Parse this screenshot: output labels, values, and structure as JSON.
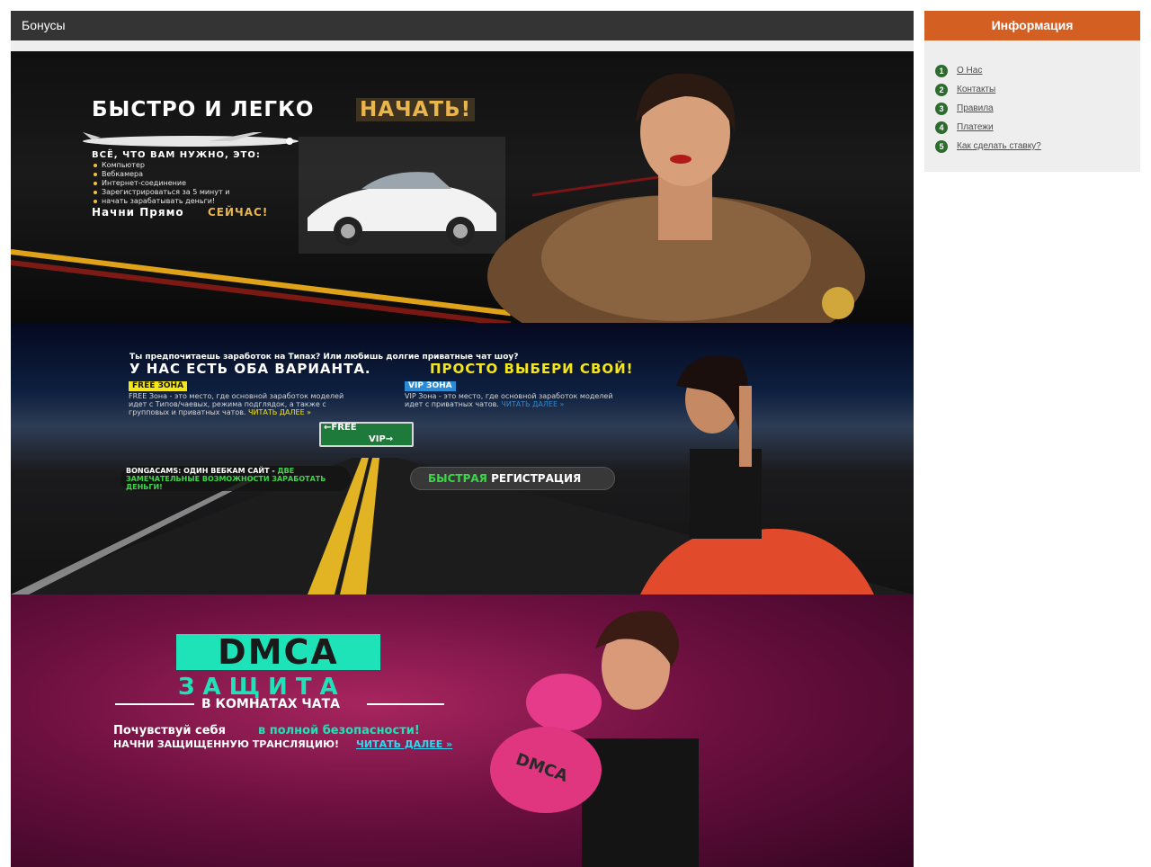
{
  "main": {
    "title": "Бонусы",
    "banners": [
      {
        "title": "БЫСТРО И ЛЕГКО",
        "title_accent": "НАЧАТЬ!",
        "need_heading": "ВСЁ, ЧТО ВАМ НУЖНО, ЭТО:",
        "items": [
          "Компьютер",
          "Вебкамера",
          "Интернет-соединение",
          "Зарегистрироваться за 5 минут и",
          "начать зарабатывать деньги!"
        ],
        "cta": "Начни Прямо",
        "cta_accent": "СЕЙЧАС!"
      },
      {
        "question": "Ты предпочитаешь заработок на Типах? Или любишь долгие приватные чат шоу?",
        "heading": "У НАС ЕСТЬ ОБА ВАРИАНТА.",
        "heading_accent": "ПРОСТО ВЫБЕРИ СВОЙ!",
        "free_tag": "FREE ЗОНА",
        "free_desc": "FREE Зона - это место, где основной заработок моделей идет с Типов/чаевых, режима подглядок, а также с групповых и приватных чатов.",
        "free_more": "ЧИТАТЬ ДАЛЕЕ »",
        "vip_tag": "VIP ЗОНА",
        "vip_desc": "VIP Зона - это место, где основной заработок моделей идет с приватных чатов.",
        "vip_more": "ЧИТАТЬ ДАЛЕЕ »",
        "sign_free": "←FREE",
        "sign_vip": "VIP→",
        "pill_left": "BONGACAMS: ОДИН ВЕБКАМ САЙТ -",
        "pill_left_accent": "ДВЕ ЗАМЕЧАТЕЛЬНЫЕ ВОЗМОЖНОСТИ ЗАРАБОТАТЬ ДЕНЬГИ!",
        "pill_right_accent": "БЫСТРАЯ",
        "pill_right": "РЕГИСТРАЦИЯ"
      },
      {
        "logo": "DMCA",
        "subtitle": "ЗАЩИТА",
        "rooms": "В КОМНАТАХ ЧАТА",
        "feel": "Почувствуй себя",
        "feel_accent": "в полной безопасности!",
        "start": "НАЧНИ ЗАЩИЩЕННУЮ ТРАНСЛЯЦИЮ!",
        "start_more": "ЧИТАТЬ ДАЛЕЕ »",
        "glove_label": "DMCA"
      }
    ]
  },
  "sidebar": {
    "title": "Информация",
    "items": [
      {
        "num": "1",
        "label": "О Нас"
      },
      {
        "num": "2",
        "label": "Контакты"
      },
      {
        "num": "3",
        "label": "Правила"
      },
      {
        "num": "4",
        "label": "Платежи"
      },
      {
        "num": "5",
        "label": "Как сделать ставку?"
      }
    ]
  },
  "colors": {
    "header_bg": "#343434",
    "sidebar_header_bg": "#d35f23",
    "number_badge": "#2e6b2f",
    "gold": "#e9b54c",
    "yellow": "#f5e61b",
    "teal": "#1ee2b8"
  }
}
